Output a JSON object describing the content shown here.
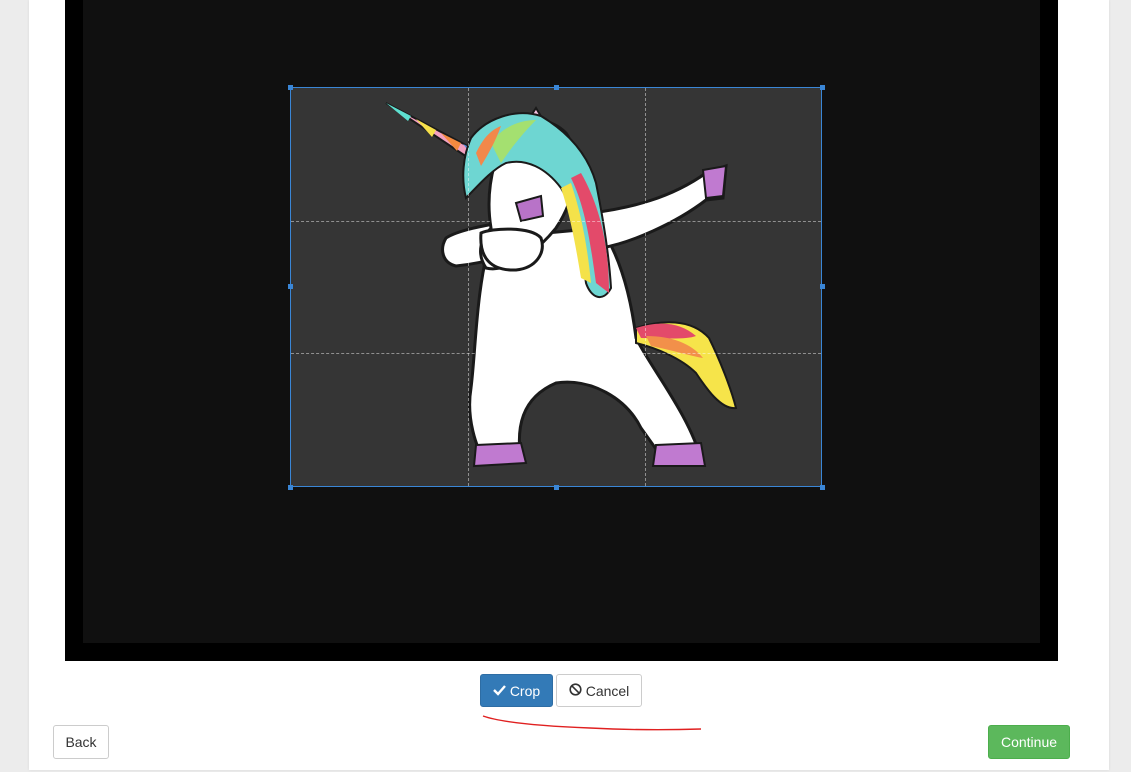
{
  "cropper": {
    "grid": "3x3 dashed guides",
    "selection_color": "#3a86d6",
    "image_subject": "dabbing unicorn"
  },
  "actions": {
    "crop_label": "Crop",
    "crop_icon": "check-icon",
    "cancel_label": "Cancel",
    "cancel_icon": "ban-icon"
  },
  "footer": {
    "back_label": "Back",
    "continue_label": "Continue"
  },
  "colors": {
    "primary": "#337ab7",
    "success": "#5cb85c",
    "annotation": "#e02020"
  }
}
